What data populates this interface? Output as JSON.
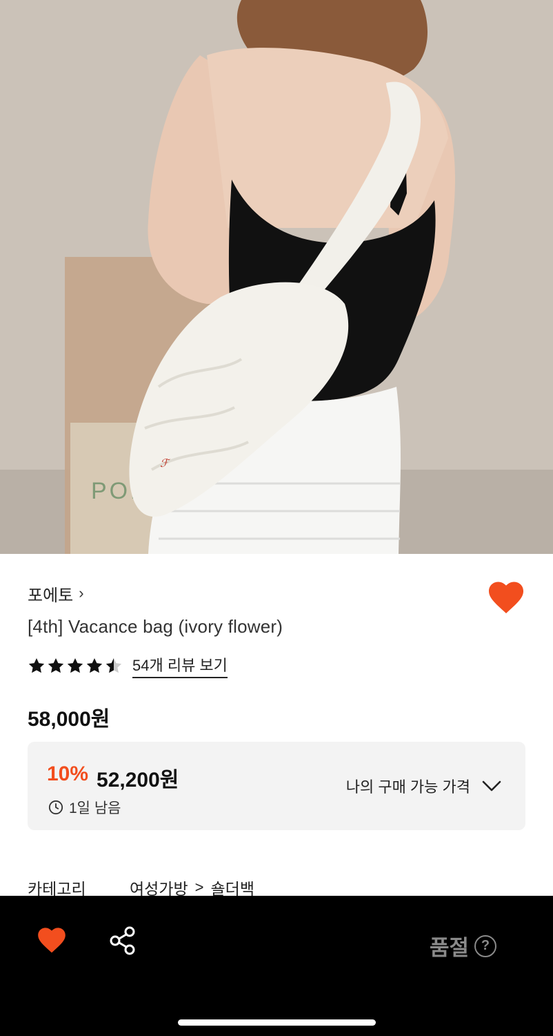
{
  "product_image": {
    "alt": "",
    "brand_mark": "POR"
  },
  "brand": {
    "name": "포에토",
    "chevron": "›"
  },
  "title": "[4th] Vacance bag (ivory flower)",
  "rating": {
    "stars": 4.5,
    "review_link": "54개 리뷰 보기"
  },
  "price": {
    "original": "58,000원"
  },
  "discount": {
    "rate": "10%",
    "price": "52,200원",
    "time_left": "1일 남음",
    "my_price_label": "나의 구매 가능 가격"
  },
  "category": {
    "label": "카테고리",
    "level1": "여성가방",
    "separator": ">",
    "level2": "숄더백"
  },
  "bottom_bar": {
    "status": "품절",
    "help_glyph": "?"
  },
  "colors": {
    "accent": "#f24e1e",
    "discount_bg": "#f3f3f3",
    "bar_bg": "#000000",
    "muted": "#8a8a8a"
  },
  "icons": [
    "heart-icon",
    "share-icon",
    "clock-icon",
    "chevron-down-icon",
    "chevron-right-icon",
    "star-icon",
    "help-icon"
  ]
}
